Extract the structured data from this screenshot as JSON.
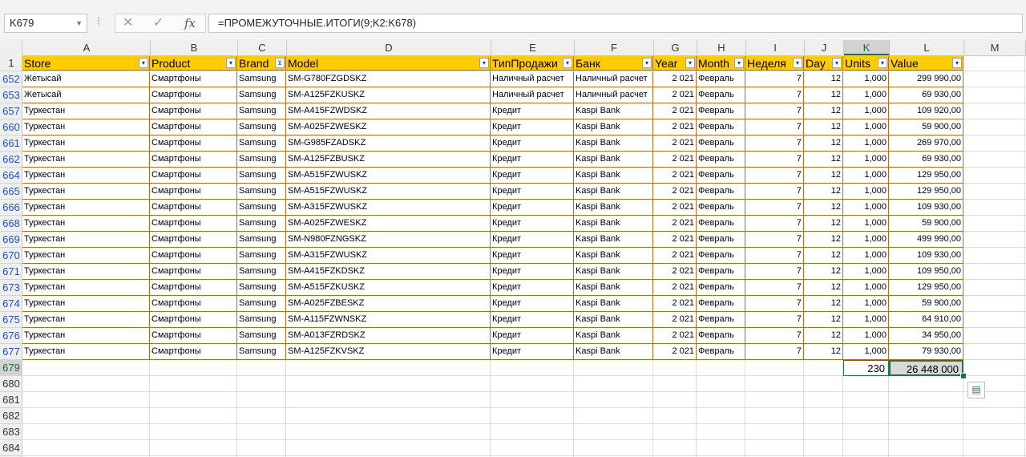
{
  "formula_bar": {
    "name_box": "K679",
    "formula": "=ПРОМЕЖУТОЧНЫЕ.ИТОГИ(9;K2:K678)",
    "cancel_glyph": "✕",
    "enter_glyph": "✓",
    "fx_label": "fx"
  },
  "columns": [
    "A",
    "B",
    "C",
    "D",
    "E",
    "F",
    "G",
    "H",
    "I",
    "J",
    "K",
    "L",
    "M"
  ],
  "table": {
    "headers": [
      "Store",
      "Product",
      "Brand",
      "Model",
      "ТипПродажи",
      "Банк",
      "Year",
      "Month",
      "Неделя",
      "Day",
      "Units",
      "Value"
    ],
    "filter_active_col": 2,
    "header_row_number": "1",
    "rows": [
      {
        "row": "652",
        "cells": [
          "Жетысай",
          "Смартфоны",
          "Samsung",
          "SM-G780FZGDSKZ",
          "Наличный расчет",
          "Наличный расчет",
          "2 021",
          "Февраль",
          "7",
          "12",
          "1,000",
          "299 990,00"
        ]
      },
      {
        "row": "653",
        "cells": [
          "Жетысай",
          "Смартфоны",
          "Samsung",
          "SM-A125FZKUSKZ",
          "Наличный расчет",
          "Наличный расчет",
          "2 021",
          "Февраль",
          "7",
          "12",
          "1,000",
          "69 930,00"
        ]
      },
      {
        "row": "657",
        "cells": [
          "Туркестан",
          "Смартфоны",
          "Samsung",
          "SM-A415FZWDSKZ",
          "Кредит",
          "Kaspi Bank",
          "2 021",
          "Февраль",
          "7",
          "12",
          "1,000",
          "109 920,00"
        ]
      },
      {
        "row": "660",
        "cells": [
          "Туркестан",
          "Смартфоны",
          "Samsung",
          "SM-A025FZWESKZ",
          "Кредит",
          "Kaspi Bank",
          "2 021",
          "Февраль",
          "7",
          "12",
          "1,000",
          "59 900,00"
        ]
      },
      {
        "row": "661",
        "cells": [
          "Туркестан",
          "Смартфоны",
          "Samsung",
          "SM-G985FZADSKZ",
          "Кредит",
          "Kaspi Bank",
          "2 021",
          "Февраль",
          "7",
          "12",
          "1,000",
          "269 970,00"
        ]
      },
      {
        "row": "662",
        "cells": [
          "Туркестан",
          "Смартфоны",
          "Samsung",
          "SM-A125FZBUSKZ",
          "Кредит",
          "Kaspi Bank",
          "2 021",
          "Февраль",
          "7",
          "12",
          "1,000",
          "69 930,00"
        ]
      },
      {
        "row": "664",
        "cells": [
          "Туркестан",
          "Смартфоны",
          "Samsung",
          "SM-A515FZWUSKZ",
          "Кредит",
          "Kaspi Bank",
          "2 021",
          "Февраль",
          "7",
          "12",
          "1,000",
          "129 950,00"
        ]
      },
      {
        "row": "665",
        "cells": [
          "Туркестан",
          "Смартфоны",
          "Samsung",
          "SM-A515FZWUSKZ",
          "Кредит",
          "Kaspi Bank",
          "2 021",
          "Февраль",
          "7",
          "12",
          "1,000",
          "129 950,00"
        ]
      },
      {
        "row": "666",
        "cells": [
          "Туркестан",
          "Смартфоны",
          "Samsung",
          "SM-A315FZWUSKZ",
          "Кредит",
          "Kaspi Bank",
          "2 021",
          "Февраль",
          "7",
          "12",
          "1,000",
          "109 930,00"
        ]
      },
      {
        "row": "668",
        "cells": [
          "Туркестан",
          "Смартфоны",
          "Samsung",
          "SM-A025FZWESKZ",
          "Кредит",
          "Kaspi Bank",
          "2 021",
          "Февраль",
          "7",
          "12",
          "1,000",
          "59 900,00"
        ]
      },
      {
        "row": "669",
        "cells": [
          "Туркестан",
          "Смартфоны",
          "Samsung",
          "SM-N980FZNGSKZ",
          "Кредит",
          "Kaspi Bank",
          "2 021",
          "Февраль",
          "7",
          "12",
          "1,000",
          "499 990,00"
        ]
      },
      {
        "row": "670",
        "cells": [
          "Туркестан",
          "Смартфоны",
          "Samsung",
          "SM-A315FZWUSKZ",
          "Кредит",
          "Kaspi Bank",
          "2 021",
          "Февраль",
          "7",
          "12",
          "1,000",
          "109 930,00"
        ]
      },
      {
        "row": "671",
        "cells": [
          "Туркестан",
          "Смартфоны",
          "Samsung",
          "SM-A415FZKDSKZ",
          "Кредит",
          "Kaspi Bank",
          "2 021",
          "Февраль",
          "7",
          "12",
          "1,000",
          "109 950,00"
        ]
      },
      {
        "row": "673",
        "cells": [
          "Туркестан",
          "Смартфоны",
          "Samsung",
          "SM-A515FZKUSKZ",
          "Кредит",
          "Kaspi Bank",
          "2 021",
          "Февраль",
          "7",
          "12",
          "1,000",
          "129 950,00"
        ]
      },
      {
        "row": "674",
        "cells": [
          "Туркестан",
          "Смартфоны",
          "Samsung",
          "SM-A025FZBESKZ",
          "Кредит",
          "Kaspi Bank",
          "2 021",
          "Февраль",
          "7",
          "12",
          "1,000",
          "59 900,00"
        ]
      },
      {
        "row": "675",
        "cells": [
          "Туркестан",
          "Смартфоны",
          "Samsung",
          "SM-A115FZWNSKZ",
          "Кредит",
          "Kaspi Bank",
          "2 021",
          "Февраль",
          "7",
          "12",
          "1,000",
          "64 910,00"
        ]
      },
      {
        "row": "676",
        "cells": [
          "Туркестан",
          "Смартфоны",
          "Samsung",
          "SM-A013FZRDSKZ",
          "Кредит",
          "Kaspi Bank",
          "2 021",
          "Февраль",
          "7",
          "12",
          "1,000",
          "34 950,00"
        ]
      },
      {
        "row": "677",
        "cells": [
          "Туркестан",
          "Смартфоны",
          "Samsung",
          "SM-A125FZKVSKZ",
          "Кредит",
          "Kaspi Bank",
          "2 021",
          "Февраль",
          "7",
          "12",
          "1,000",
          "79 930,00"
        ]
      }
    ]
  },
  "totals": {
    "row": "679",
    "units": "230",
    "value": "26 448 000"
  },
  "empty_rows": [
    "680",
    "681",
    "682",
    "683",
    "684"
  ],
  "icons": {
    "filter": "dropdown-arrow-icon",
    "filter_active": "filter-funnel-icon",
    "quick_analysis": "quick-analysis-icon"
  },
  "colors": {
    "header_fill": "#ffcc00",
    "cell_border": "#b56a1c",
    "selection": "#217346",
    "filtered_row_number": "#1f4fbf"
  }
}
